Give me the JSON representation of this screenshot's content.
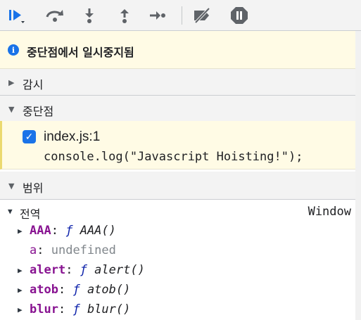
{
  "toolbar": {
    "buttons": [
      {
        "icon": "resume-icon"
      },
      {
        "icon": "step-over-icon"
      },
      {
        "icon": "step-into-icon"
      },
      {
        "icon": "step-out-icon"
      },
      {
        "icon": "step-icon"
      },
      {
        "icon": "deactivate-breakpoints-icon"
      },
      {
        "icon": "pause-on-exceptions-icon"
      }
    ]
  },
  "banner": {
    "text": "중단점에서 일시중지됨",
    "icon": "info-icon"
  },
  "sections": {
    "watch": "감시",
    "breakpoints": "중단점",
    "scope": "범위"
  },
  "breakpoint": {
    "checked": true,
    "location": "index.js:1",
    "code": "console.log(\"Javascript Hoisting!\");"
  },
  "scope": {
    "global_label": "전역",
    "global_value": "Window",
    "properties": [
      {
        "name": "AAA",
        "f": "ƒ",
        "value": "AAA()",
        "expandable": true
      },
      {
        "name": "a",
        "value": "undefined",
        "expandable": false
      },
      {
        "name": "alert",
        "f": "ƒ",
        "value": "alert()",
        "expandable": true
      },
      {
        "name": "atob",
        "f": "ƒ",
        "value": "atob()",
        "expandable": true
      },
      {
        "name": "blur",
        "f": "ƒ",
        "value": "blur()",
        "expandable": true
      }
    ]
  },
  "colors": {
    "accent": "#1a73e8",
    "banner_bg": "#fffbe5",
    "property_name": "#881391",
    "function_symbol": "#0d22aa"
  }
}
